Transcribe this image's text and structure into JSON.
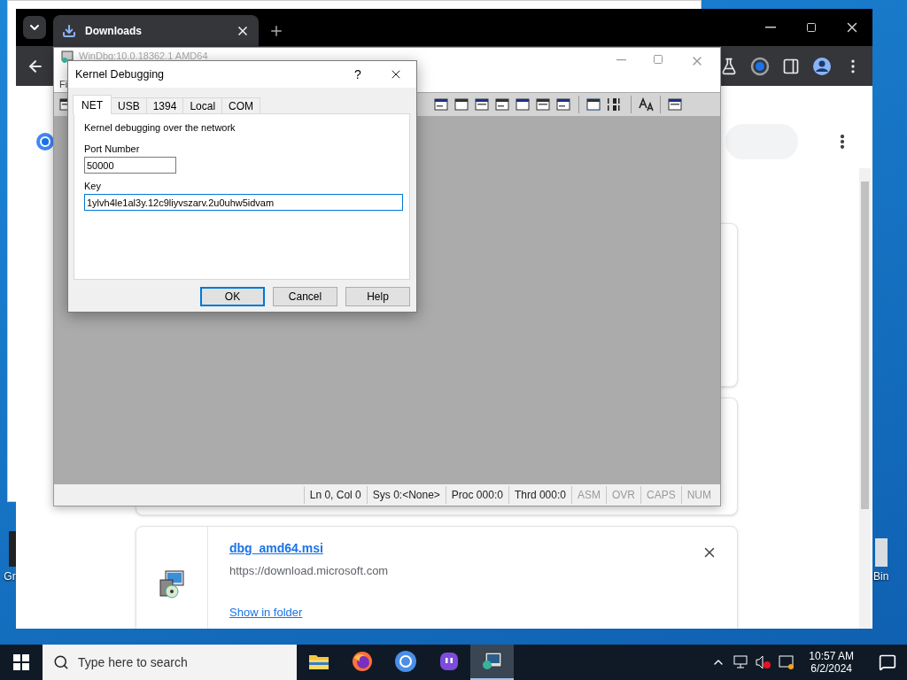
{
  "desktop": {
    "icons": [
      {
        "label": "Gr"
      },
      {
        "label": "Bin"
      }
    ]
  },
  "browser": {
    "tabs": [
      {
        "title": "Downloads",
        "selected": true
      }
    ],
    "download": {
      "file_name": "dbg_amd64.msi",
      "source": "https://download.microsoft.com",
      "action": "Show in folder"
    }
  },
  "debugger": {
    "title": "WinDbg:10.0.18362.1 AMD64",
    "menu": [
      "Fi"
    ],
    "status_bar": [
      {
        "text": "Ln 0, Col 0",
        "disabled": false
      },
      {
        "text": "Sys 0:<None>",
        "disabled": false
      },
      {
        "text": "Proc 000:0",
        "disabled": false
      },
      {
        "text": "Thrd 000:0",
        "disabled": false
      },
      {
        "text": "ASM",
        "disabled": true
      },
      {
        "text": "OVR",
        "disabled": true
      },
      {
        "text": "CAPS",
        "disabled": true
      },
      {
        "text": "NUM",
        "disabled": true
      }
    ]
  },
  "dialog": {
    "title": "Kernel Debugging",
    "help_button": "?",
    "tabs": [
      {
        "label": "NET",
        "selected": true
      },
      {
        "label": "USB",
        "selected": false
      },
      {
        "label": "1394",
        "selected": false
      },
      {
        "label": "Local",
        "selected": false
      },
      {
        "label": "COM",
        "selected": false
      }
    ],
    "description": "Kernel debugging over the network",
    "fields": [
      {
        "label": "Port Number",
        "value": "50000",
        "focused": false
      },
      {
        "label": "Key",
        "value": "1ylvh4le1al3y.12c9liyvszarv.2u0uhw5idvam",
        "focused": true
      }
    ],
    "buttons": [
      {
        "label": "OK",
        "default": true
      },
      {
        "label": "Cancel",
        "default": false
      },
      {
        "label": "Help",
        "default": false
      }
    ]
  },
  "taskbar": {
    "search_placeholder": "Type here to search",
    "apps": [
      {
        "kind": "folder",
        "selected": false
      },
      {
        "kind": "fox",
        "selected": false
      },
      {
        "kind": "browser",
        "selected": false
      },
      {
        "kind": "chat",
        "selected": false
      },
      {
        "kind": "debugger",
        "selected": true
      }
    ],
    "time": "10:57 AM",
    "date": "6/2/2024"
  }
}
